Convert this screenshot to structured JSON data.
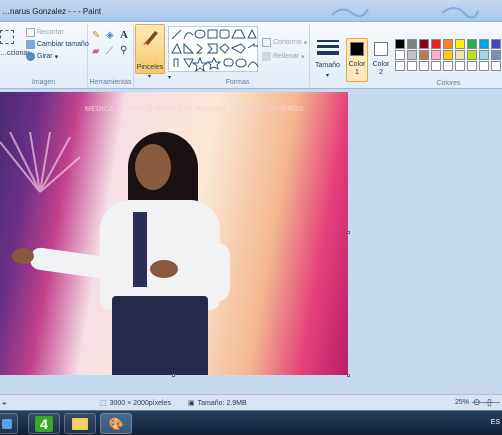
{
  "window": {
    "title": "…narus Gonzalez - - - Paint"
  },
  "ribbon": {
    "image_group": {
      "label": "Imagen",
      "select_label": "…ccionar",
      "crop_label": "Recortar",
      "resize_label": "Cambiar tamaño",
      "rotate_label": "Girar"
    },
    "tools_group": {
      "label": "Herramientas"
    },
    "brushes_label": "Pinceles",
    "shapes_group": {
      "label": "Formas",
      "outline_label": "Contorno",
      "fill_label": "Rellenar"
    },
    "size_label": "Tamaño",
    "color1": {
      "line1": "Color",
      "line2": "1",
      "value": "#000000"
    },
    "color2": {
      "line1": "Color",
      "line2": "2",
      "value": "#ffffff"
    },
    "colors_group": {
      "label": "Colores"
    },
    "palette": [
      "#000000",
      "#7f7f7f",
      "#880015",
      "#ed1c24",
      "#ff7f27",
      "#fff200",
      "#22b14c",
      "#00a2e8",
      "#3f48cc",
      "#ffffff",
      "#c3c3c3",
      "#b97a57",
      "#ffaec9",
      "#ffc90e",
      "#efe4b0",
      "#b5e61d",
      "#99d9ea",
      "#7092be",
      "#ffffff",
      "#ffffff",
      "#ffffff",
      "#ffffff",
      "#ffffff",
      "#ffffff",
      "#ffffff",
      "#ffffff",
      "#ffffff"
    ]
  },
  "canvas": {
    "banner_text": "MEDICA · CABLE & WIRELESS PANAMA · CAJA DE AHORROS"
  },
  "statusbar": {
    "dimensions": "3000 × 2000píxeles",
    "file_size": "Tamaño: 2.9MB",
    "zoom": "25%"
  },
  "taskbar": {
    "tray_text": "ES"
  }
}
